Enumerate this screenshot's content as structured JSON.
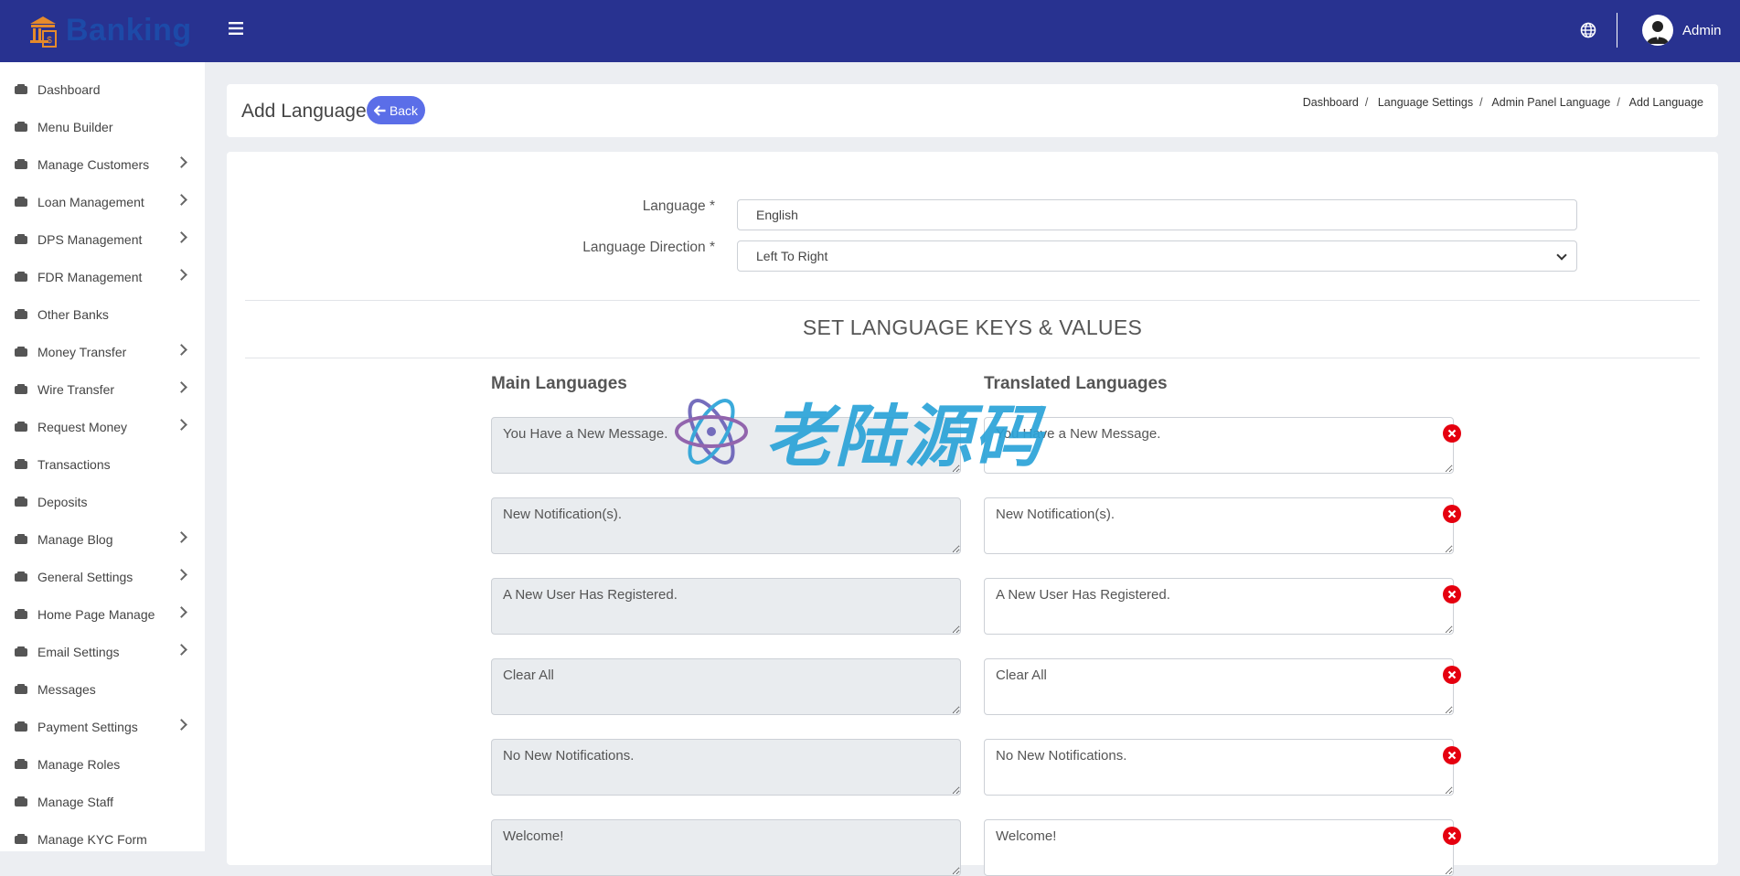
{
  "brand": {
    "name": "Banking"
  },
  "topbar": {
    "user_name": "Admin"
  },
  "sidebar": {
    "items": [
      {
        "label": "Dashboard",
        "icon": "gauge-icon",
        "has_children": false
      },
      {
        "label": "Menu Builder",
        "icon": "compass-icon",
        "has_children": false
      },
      {
        "label": "Manage Customers",
        "icon": "user-icon",
        "has_children": true
      },
      {
        "label": "Loan Management",
        "icon": "building-icon",
        "has_children": true
      },
      {
        "label": "DPS Management",
        "icon": "bank-icon",
        "has_children": true
      },
      {
        "label": "FDR Management",
        "icon": "user-cog-icon",
        "has_children": true
      },
      {
        "label": "Other Banks",
        "icon": "institution-icon",
        "has_children": false
      },
      {
        "label": "Money Transfer",
        "icon": "exchange-icon",
        "has_children": true
      },
      {
        "label": "Wire Transfer",
        "icon": "wallet-icon",
        "has_children": true
      },
      {
        "label": "Request Money",
        "icon": "coin-icon",
        "has_children": true
      },
      {
        "label": "Transactions",
        "icon": "chart-line-icon",
        "has_children": false
      },
      {
        "label": "Deposits",
        "icon": "piggy-bank-icon",
        "has_children": false
      },
      {
        "label": "Manage Blog",
        "icon": "blog-icon",
        "has_children": true
      },
      {
        "label": "General Settings",
        "icon": "cogs-icon",
        "has_children": true
      },
      {
        "label": "Home Page Manage",
        "icon": "home-icon",
        "has_children": true
      },
      {
        "label": "Email Settings",
        "icon": "envelope-icon",
        "has_children": true
      },
      {
        "label": "Messages",
        "icon": "inbox-icon",
        "has_children": false
      },
      {
        "label": "Payment Settings",
        "icon": "credit-card-icon",
        "has_children": true
      },
      {
        "label": "Manage Roles",
        "icon": "crop-icon",
        "has_children": false
      },
      {
        "label": "Manage Staff",
        "icon": "users-icon",
        "has_children": false
      },
      {
        "label": "Manage KYC Form",
        "icon": "child-icon",
        "has_children": false
      }
    ]
  },
  "header": {
    "title": "Add Language",
    "back_label": "Back",
    "breadcrumb": [
      "Dashboard",
      "Language Settings",
      "Admin Panel Language",
      "Add Language"
    ]
  },
  "form": {
    "language_label": "Language *",
    "language_value": "English",
    "direction_label": "Language Direction *",
    "direction_value": "Left To Right",
    "section_title": "SET LANGUAGE KEYS & VALUES",
    "main_col_title": "Main Languages",
    "translated_col_title": "Translated Languages",
    "rows": [
      {
        "main": "You Have a New Message.",
        "translated": "You Have a New Message."
      },
      {
        "main": "New Notification(s).",
        "translated": "New Notification(s)."
      },
      {
        "main": "A New User Has Registered.",
        "translated": "A New User Has Registered."
      },
      {
        "main": "Clear All",
        "translated": "Clear All"
      },
      {
        "main": "No New Notifications.",
        "translated": "No New Notifications."
      },
      {
        "main": "Welcome!",
        "translated": "Welcome!"
      }
    ]
  },
  "watermark": {
    "text": "老陆源码"
  },
  "colors": {
    "topbar": "#283290",
    "accent": "#5b6ee8",
    "danger": "#e5000f"
  }
}
